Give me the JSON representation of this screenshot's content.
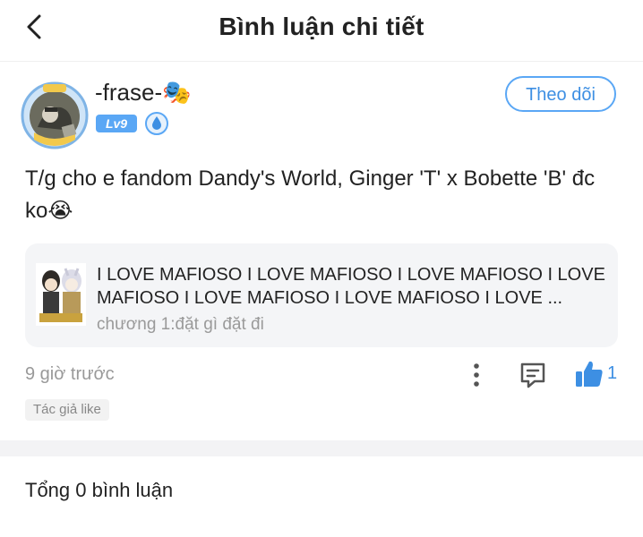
{
  "header": {
    "back_icon": "chevron-left-icon",
    "title": "Bình luận chi tiết"
  },
  "author": {
    "name": "-frase-",
    "name_emoji": "🎭",
    "level": "Lv9",
    "follow_label": "Theo dõi",
    "colors": {
      "accent": "#5aa7f5",
      "accent_text": "#3d8fe3"
    }
  },
  "comment": {
    "text": "T/g cho e fandom Dandy's World, Ginger 'T' x Bobette 'B' đc ko😭"
  },
  "quote": {
    "title": "I LOVE MAFIOSO I LOVE MAFIOSO I LOVE MAFIOSO I LOVE MAFIOSO I LOVE MAFIOSO I LOVE MAFIOSO I LOVE ...",
    "subtitle": "chương 1:đặt gì đặt đi"
  },
  "meta": {
    "time": "9 giờ trước",
    "like_count": "1",
    "author_like_badge": "Tác giả like",
    "icons": [
      "more-vertical-icon",
      "reply-icon",
      "thumbs-up-icon"
    ]
  },
  "footer": {
    "total": "Tổng 0 bình luận"
  }
}
